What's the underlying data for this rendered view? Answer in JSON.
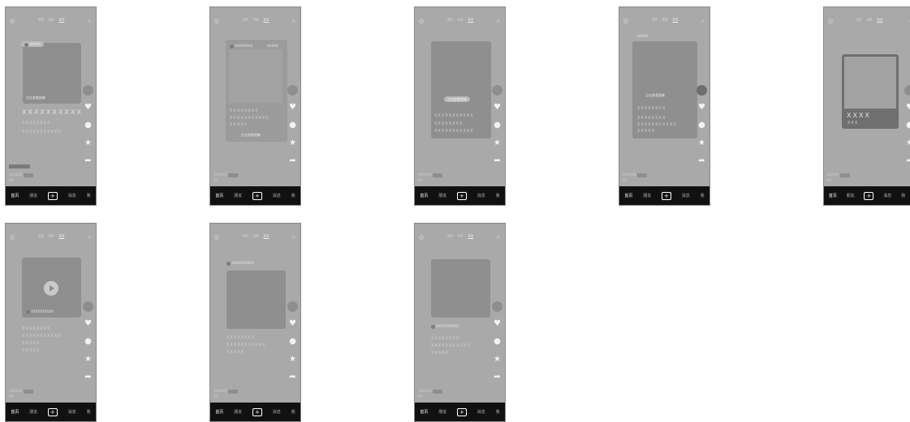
{
  "tabs": [
    "XX",
    "XX",
    "XX"
  ],
  "nav": {
    "home": "首页",
    "friends": "朋友",
    "plus": "+",
    "messages": "消息",
    "me": "我"
  },
  "chip_author": "XXXXX",
  "video_hint": "点击查看图集",
  "expand_hint": "点击查看图集",
  "ellipsis": "···",
  "x_long": "XXXXXXXXXX",
  "x_med": "XXXXXXXX",
  "x_short": "XXXXX",
  "x_line": "XXXXXXXXXXX",
  "x_big": "XXXX",
  "x_big_sub": "XXX",
  "author_name": "XXXXXX",
  "author_sub": "XX",
  "icons": {
    "left": "◎",
    "search": "⌕",
    "heart": "♥",
    "comment": "●",
    "star": "★",
    "share": "➦"
  }
}
